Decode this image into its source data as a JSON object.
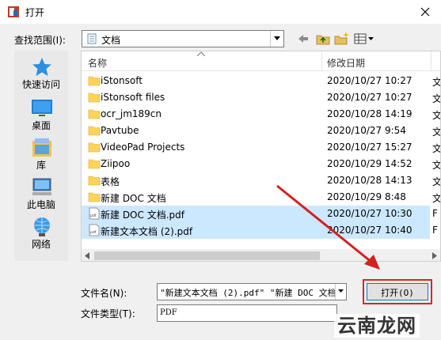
{
  "window": {
    "title": "打开"
  },
  "lookin": {
    "label": "查找范围(I):",
    "value": "文档"
  },
  "places": [
    {
      "label": "快速访问",
      "icon": "star-icon"
    },
    {
      "label": "桌面",
      "icon": "desktop-icon"
    },
    {
      "label": "库",
      "icon": "library-icon"
    },
    {
      "label": "此电脑",
      "icon": "computer-icon"
    },
    {
      "label": "网络",
      "icon": "network-icon"
    }
  ],
  "list": {
    "columns": {
      "name": "名称",
      "modified": "修改日期"
    },
    "rows": [
      {
        "name": "iStonsoft",
        "date": "2020/10/27 10:27",
        "extra": "文",
        "type": "folder",
        "selected": false
      },
      {
        "name": "iStonsoft files",
        "date": "2020/10/27 10:27",
        "extra": "文",
        "type": "folder",
        "selected": false
      },
      {
        "name": "ocr_jm189cn",
        "date": "2020/10/28 14:19",
        "extra": "文",
        "type": "folder",
        "selected": false
      },
      {
        "name": "Pavtube",
        "date": "2020/10/27 9:54",
        "extra": "文",
        "type": "folder",
        "selected": false
      },
      {
        "name": "VideoPad Projects",
        "date": "2020/10/27 15:27",
        "extra": "文",
        "type": "folder",
        "selected": false
      },
      {
        "name": "Ziipoo",
        "date": "2020/10/29 14:52",
        "extra": "文",
        "type": "folder",
        "selected": false
      },
      {
        "name": "表格",
        "date": "2020/10/28 14:13",
        "extra": "文",
        "type": "folder",
        "selected": false
      },
      {
        "name": "新建 DOC 文档",
        "date": "2020/10/29 8:48",
        "extra": "文",
        "type": "folder",
        "selected": false
      },
      {
        "name": "新建 DOC 文档.pdf",
        "date": "2020/10/27 10:30",
        "extra": "F",
        "type": "pdf",
        "selected": true
      },
      {
        "name": "新建文本文档 (2).pdf",
        "date": "2020/10/27 10:40",
        "extra": "F",
        "type": "pdf",
        "selected": true
      }
    ]
  },
  "filename": {
    "label": "文件名(N):",
    "value": "\"新建文本文档 (2).pdf\" \"新建 DOC 文档."
  },
  "filetype": {
    "label": "文件类型(T):",
    "value": "PDF"
  },
  "buttons": {
    "open": "打开(O)"
  },
  "watermark": {
    "text": "云南龙网"
  },
  "colors": {
    "selection": "#cce8ff",
    "highlight": "#e2231a",
    "folder": "#ffd35c"
  }
}
